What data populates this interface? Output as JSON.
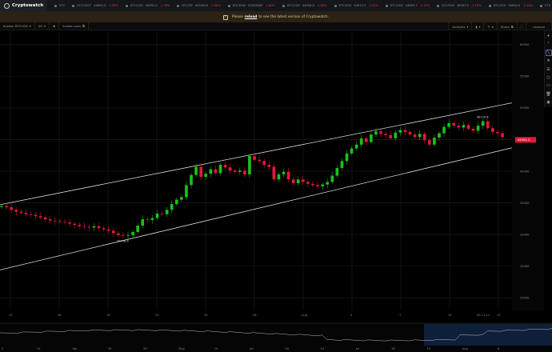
{
  "app": {
    "name": "Cryptowatch"
  },
  "ticker": [
    {
      "symbol": "BTC",
      "price": "",
      "change": ""
    },
    {
      "symbol": "BTC/USDT",
      "price": "44953.3",
      "change": "-2.39%"
    },
    {
      "symbol": "BTC/USD",
      "price": "44931.0",
      "change": "-1.78%"
    },
    {
      "symbol": "BTC/JPY",
      "price": "4933019",
      "change": "-1.88%"
    },
    {
      "symbol": "BTC/KRW",
      "price": "53202000",
      "change": "-1.80%"
    },
    {
      "symbol": "BTC/USD",
      "price": "44916.0",
      "change": "-2.08%"
    },
    {
      "symbol": "BTC/USD",
      "price": "44913.2",
      "change": "-2.01%"
    },
    {
      "symbol": "BTC/USD",
      "price": "44953.7",
      "change": "-2.10%"
    },
    {
      "symbol": "BTC/EUR",
      "price": "38397.0",
      "change": "-2.10%"
    },
    {
      "symbol": "BTC/USD",
      "price": "44930.5",
      "change": "-2.18%"
    },
    {
      "symbol": "ETH",
      "price": "",
      "change": ""
    }
  ],
  "banner": {
    "before": "Please",
    "link": "reload",
    "after": "to see the latest version of Cryptowatch."
  },
  "toolbar": {
    "market": "Kraken BTCUSD",
    "interval": "4H",
    "source": "kraken.com",
    "analysis": "Analysis",
    "share": "Share",
    "mode": "manual"
  },
  "chart_data": {
    "type": "candlestick",
    "market": "BTCUSD",
    "exchange": "kraken.com",
    "interval": "4H",
    "y_ticks": [
      20000,
      25000,
      30000,
      35000,
      40000,
      45000,
      50000,
      55000,
      60000
    ],
    "ylim": [
      18000,
      62000
    ],
    "x_ticks": [
      "13",
      "16",
      "19",
      "22",
      "25",
      "28",
      "Aug",
      "4",
      "7",
      "10",
      "13"
    ],
    "crosshair_time": "02:11:11",
    "current_price": "44953.3",
    "annotations": [
      {
        "label": "48134.8",
        "value": 48134.8,
        "kind": "high"
      },
      {
        "label": "29708.6",
        "value": 29708.6,
        "kind": "low"
      }
    ],
    "channel": {
      "upper": [
        [
          0,
          34700
        ],
        [
          1,
          50800
        ]
      ],
      "lower": [
        [
          0,
          24400
        ],
        [
          1,
          43700
        ]
      ]
    },
    "close_series": [
      34500,
      34300,
      33900,
      33600,
      33400,
      33200,
      33100,
      32900,
      32700,
      32400,
      32200,
      32100,
      32000,
      31900,
      31700,
      31500,
      31300,
      31200,
      31100,
      31300,
      31000,
      30800,
      30600,
      30200,
      29900,
      29800,
      29900,
      30400,
      31400,
      32400,
      32300,
      32600,
      33300,
      33200,
      33900,
      34800,
      35500,
      35900,
      37800,
      39400,
      40700,
      39100,
      39600,
      40300,
      39700,
      41000,
      40600,
      40100,
      39900,
      40100,
      39500,
      42400,
      41800,
      41600,
      41000,
      40700,
      38700,
      39500,
      39900,
      38700,
      38100,
      38700,
      38300,
      38000,
      37800,
      37600,
      37900,
      38300,
      39300,
      40500,
      41600,
      42800,
      43600,
      44200,
      45200,
      44600,
      45800,
      46300,
      45900,
      45700,
      45200,
      46100,
      46500,
      46200,
      45800,
      45400,
      45900,
      44900,
      44200,
      45300,
      46000,
      47000,
      47600,
      47200,
      46900,
      47300,
      46700,
      46400,
      47200,
      47900,
      46800,
      46200,
      46000,
      45400
    ],
    "navigator": {
      "x_ticks": [
        "2",
        "21",
        "Apr",
        "10",
        "29",
        "May",
        "19",
        "Jun",
        "16",
        "19",
        "Jul",
        "16",
        "19",
        "Aug",
        "8"
      ]
    },
    "colors": {
      "up": "#17c417",
      "down": "#e8173a",
      "grid": "#1e1e1e",
      "channel": "#d8d8d8",
      "price_tag": "#e8173a"
    }
  }
}
